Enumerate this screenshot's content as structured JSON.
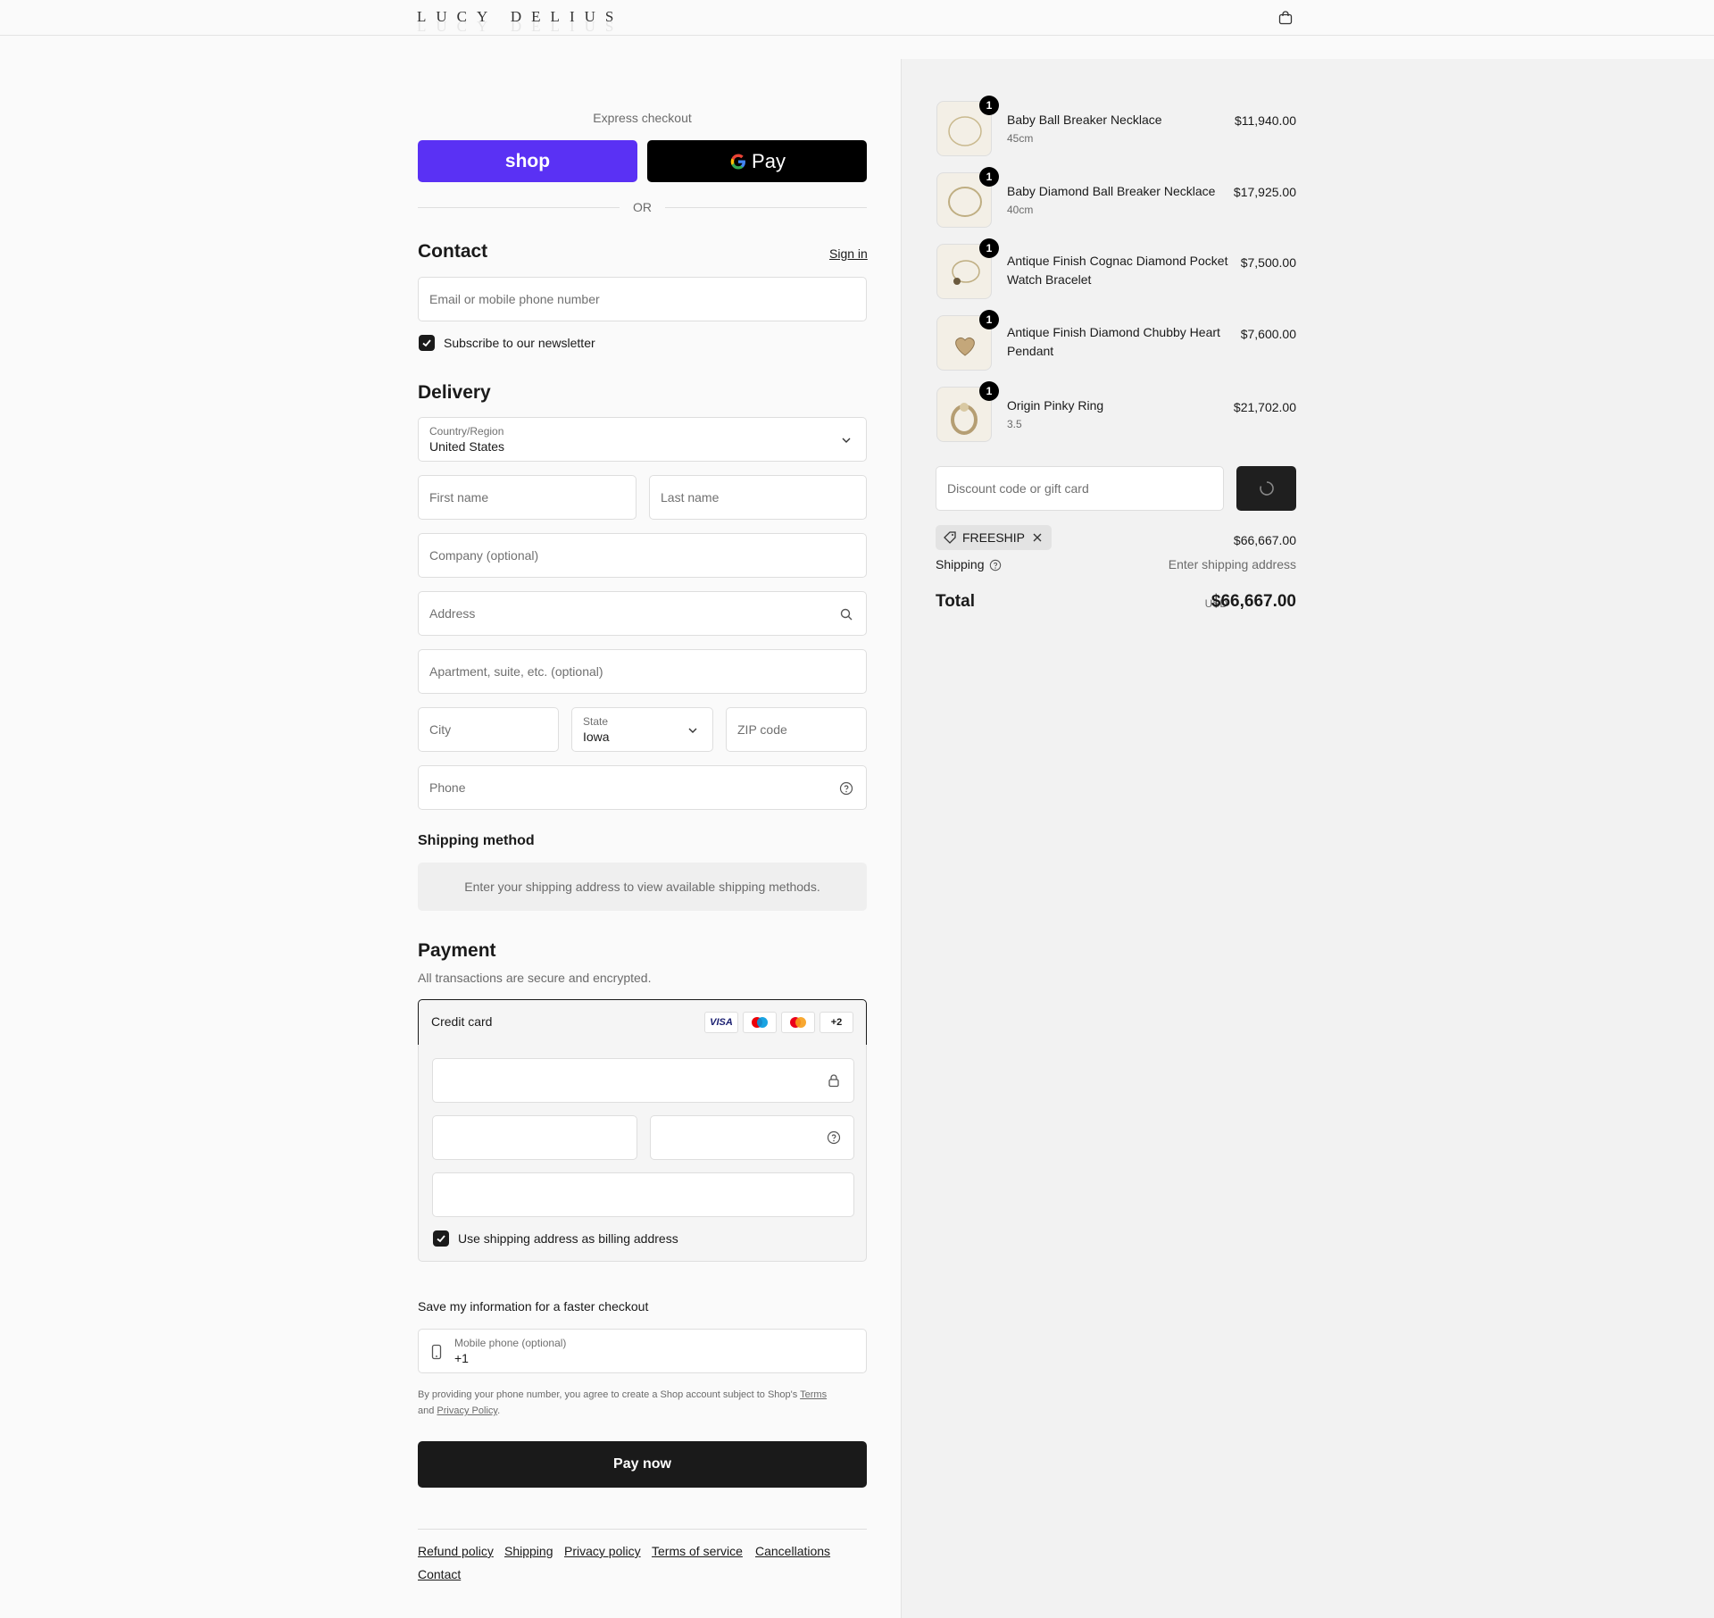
{
  "header": {
    "logo": "LUCY DELIUS"
  },
  "express": {
    "label": "Express checkout",
    "shop_label": "shop",
    "gpay_label": "Pay",
    "or_label": "OR"
  },
  "contact": {
    "title": "Contact",
    "sign_in": "Sign in",
    "email_placeholder": "Email or mobile phone number",
    "newsletter_label": "Subscribe to our newsletter"
  },
  "delivery": {
    "title": "Delivery",
    "country_label": "Country/Region",
    "country_value": "United States",
    "first_name": "First name",
    "last_name": "Last name",
    "company": "Company (optional)",
    "address": "Address",
    "apartment": "Apartment, suite, etc. (optional)",
    "city": "City",
    "state_label": "State",
    "state_value": "Iowa",
    "zip": "ZIP code",
    "phone": "Phone"
  },
  "shipping_method": {
    "title": "Shipping method",
    "note": "Enter your shipping address to view available shipping methods."
  },
  "payment": {
    "title": "Payment",
    "subtitle": "All transactions are secure and encrypted.",
    "method_label": "Credit card",
    "cards": [
      "VISA",
      "Maestro",
      "Mastercard",
      "+2"
    ],
    "billing_label": "Use shipping address as billing address"
  },
  "save_info": {
    "title": "Save my information for a faster checkout",
    "mobile_label": "Mobile phone (optional)",
    "mobile_value": "+1",
    "legal_prefix": "By providing your phone number, you agree to create a Shop account subject to Shop's",
    "terms": "Terms",
    "legal_and": "and",
    "privacy": "Privacy Policy",
    "legal_end": "."
  },
  "pay_now": "Pay now",
  "footer": {
    "links": [
      "Refund policy",
      "Shipping",
      "Privacy policy",
      "Terms of service",
      "Cancellations",
      "Contact"
    ]
  },
  "summary": {
    "items": [
      {
        "name": "Baby Ball Breaker Necklace",
        "variant": "45cm",
        "price": "$11,940.00",
        "qty": "1"
      },
      {
        "name": "Baby Diamond Ball Breaker Necklace",
        "variant": "40cm",
        "price": "$17,925.00",
        "qty": "1"
      },
      {
        "name": "Antique Finish Cognac Diamond Pocket Watch Bracelet",
        "variant": "",
        "price": "$7,500.00",
        "qty": "1"
      },
      {
        "name": "Antique Finish Diamond Chubby Heart Pendant",
        "variant": "",
        "price": "$7,600.00",
        "qty": "1"
      },
      {
        "name": "Origin Pinky Ring",
        "variant": "3.5",
        "price": "$21,702.00",
        "qty": "1"
      }
    ],
    "discount_placeholder": "Discount code or gift card",
    "applied_code": "FREESHIP",
    "subtotal": "$66,667.00",
    "shipping_label": "Shipping",
    "shipping_value": "Enter shipping address",
    "total_label": "Total",
    "currency": "USD",
    "total_value": "$66,667.00"
  },
  "colors": {
    "shop_purple": "#5a31f4",
    "button_dark": "#1a1a1a"
  }
}
